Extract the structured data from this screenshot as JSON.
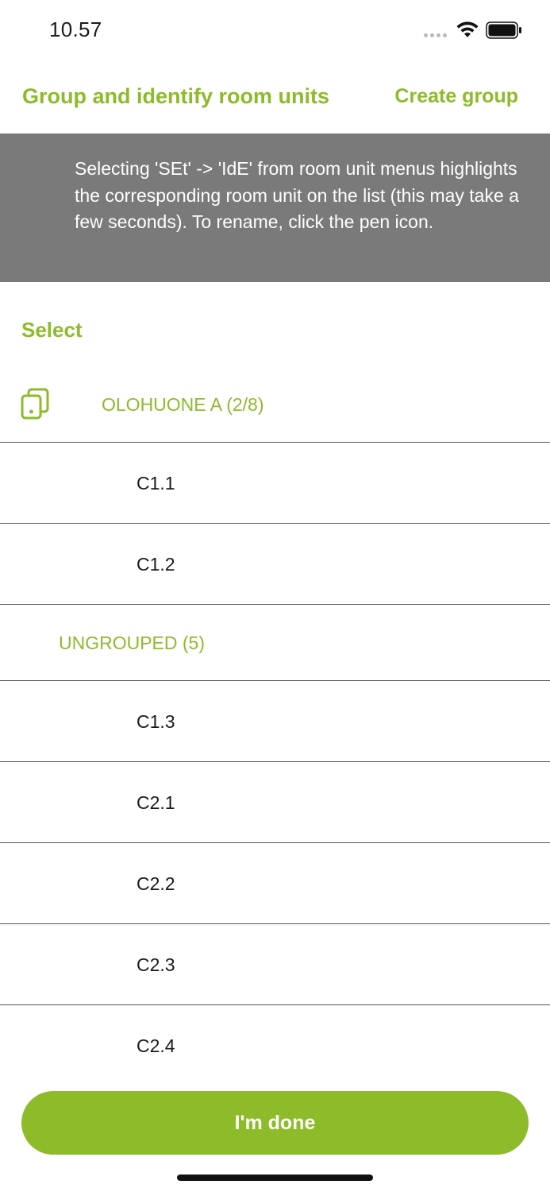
{
  "status_bar": {
    "time": "10.57",
    "icons": [
      "signal-dots-icon",
      "wifi-icon",
      "battery-icon"
    ]
  },
  "header": {
    "title": "Group and identify room units",
    "create_group_label": "Create group"
  },
  "banner": {
    "text": "Selecting 'SEt' -> 'IdE' from room unit menus highlights the corresponding room unit on the list (this may take a few seconds). To rename, click the pen icon."
  },
  "select_label": "Select",
  "groups": [
    {
      "name": "OLOHUONE A (2/8)",
      "icon": "copy-device-icon",
      "units": [
        "C1.1",
        "C1.2"
      ]
    },
    {
      "name": "UNGROUPED (5)",
      "units": [
        "C1.3",
        "C2.1",
        "C2.2",
        "C2.3",
        "C2.4"
      ]
    }
  ],
  "done_button_label": "I'm done",
  "colors": {
    "accent": "#8dbb2a",
    "banner_bg": "#7a7a7a",
    "divider": "#555555"
  }
}
